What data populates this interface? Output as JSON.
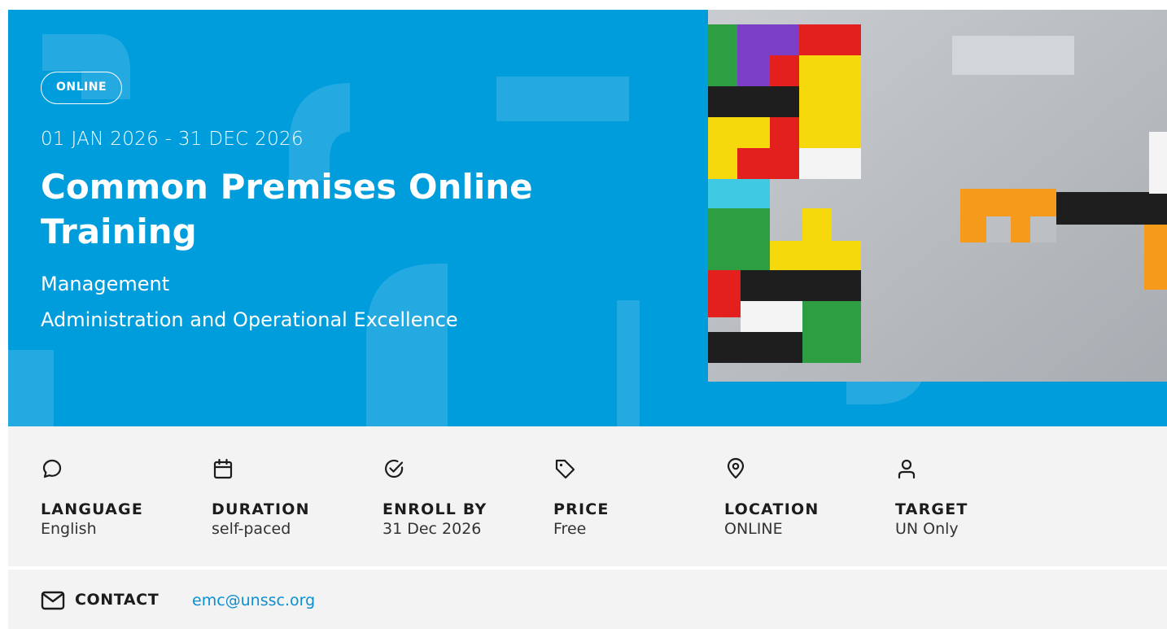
{
  "hero": {
    "badge": "ONLINE",
    "dates": "01 JAN 2026 - 31 DEC 2026",
    "title": "Common Premises Online Training",
    "categories": [
      "Management",
      "Administration and Operational Excellence"
    ],
    "background_color": "#009ddd",
    "image_icon": "wooden-puzzle-blocks-image"
  },
  "details": [
    {
      "icon": "chat-bubble-icon",
      "label": "LANGUAGE",
      "value": "English"
    },
    {
      "icon": "calendar-icon",
      "label": "DURATION",
      "value": "self-paced"
    },
    {
      "icon": "check-circle-icon",
      "label": "ENROLL BY",
      "value": "31 Dec 2026"
    },
    {
      "icon": "price-tag-icon",
      "label": "PRICE",
      "value": "Free"
    },
    {
      "icon": "location-pin-icon",
      "label": "LOCATION",
      "value": "ONLINE"
    },
    {
      "icon": "user-icon",
      "label": "TARGET",
      "value": "UN Only"
    }
  ],
  "contact": {
    "icon": "envelope-icon",
    "label": "CONTACT",
    "email": "emc@unssc.org",
    "link_color": "#0a8fd1"
  }
}
